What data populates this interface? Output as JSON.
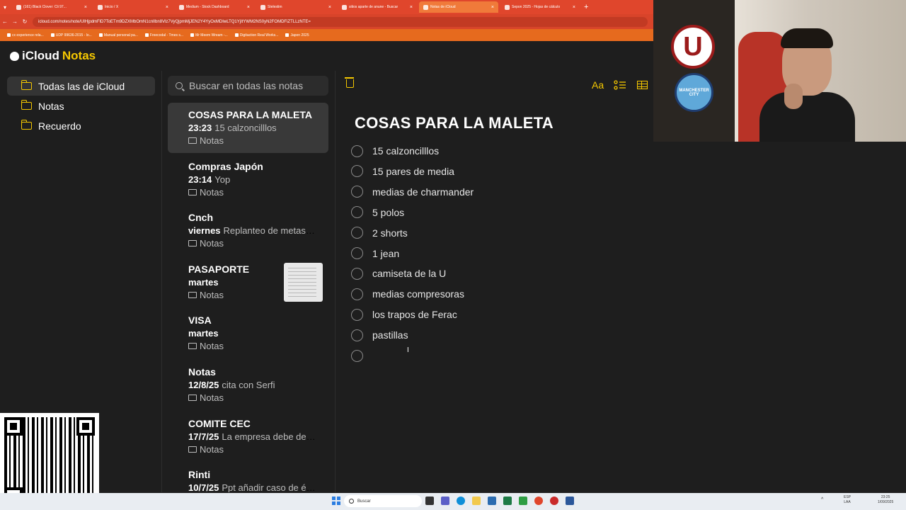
{
  "browser": {
    "tabs": [
      {
        "label": "(161) Black Clover: Cli 97...",
        "active": false
      },
      {
        "label": "Inicio / X",
        "active": false
      },
      {
        "label": "Medium - Stock Dashboard",
        "active": false
      },
      {
        "label": "Stelestim",
        "active": false
      },
      {
        "label": "sitios aparte de anune - Buscar",
        "active": false
      },
      {
        "label": "Notas de iCloud",
        "active": true
      },
      {
        "label": "Sepon 2025 - Hojas de cálculo",
        "active": false
      }
    ],
    "url": "icloud.com/notes/note/UlHjpdmFlD7ToETm9DZXMbOmN1cnlIbn8Vlz7VyQjpmMjJEN2Y4YyOxMDIwLTQ1YjItYWM2NS0yN2FOMDFiZTLLzNTE=",
    "bookmarks": [
      "cx experience rela...",
      "UDP 99636-2015 - lo...",
      "Manual personal pa...",
      "Freecodal - Tmes s...",
      "Mr Meem Wream -...",
      "Digitaction Real Works...",
      "Japon 2025"
    ]
  },
  "app": {
    "brand": {
      "icloud": "iCloud",
      "notes": "Notas"
    },
    "folders": [
      {
        "label": "Todas las de iCloud",
        "selected": true,
        "icon": "folder-icon"
      },
      {
        "label": "Notas",
        "selected": false,
        "icon": "folder-icon"
      },
      {
        "label": "Recuerdo",
        "selected": false,
        "icon": "folder-icon"
      }
    ],
    "search": {
      "placeholder": "Buscar en todas las notas"
    },
    "notes": [
      {
        "title": "COSAS PARA LA MALETA",
        "date": "23:23",
        "preview": "15 calzoncilllos",
        "folder": "Notas",
        "selected": true,
        "thumbnail": false
      },
      {
        "title": "Compras Japón",
        "date": "23:14",
        "preview": "Yop",
        "folder": "Notas",
        "selected": false,
        "thumbnail": false
      },
      {
        "title": "Cnch",
        "date": "viernes",
        "preview": "Replanteo de metas para el año",
        "folder": "Notas",
        "selected": false,
        "thumbnail": false
      },
      {
        "title": "PASAPORTE",
        "date": "martes",
        "preview": "",
        "folder": "Notas",
        "selected": false,
        "thumbnail": true
      },
      {
        "title": "VISA",
        "date": "martes",
        "preview": "",
        "folder": "Notas",
        "selected": false,
        "thumbnail": false
      },
      {
        "title": "Notas",
        "date": "12/8/25",
        "preview": "cita con Serfi",
        "folder": "Notas",
        "selected": false,
        "thumbnail": false
      },
      {
        "title": "COMITE CEC",
        "date": "17/7/25",
        "preview": "La empresa debe de cumplir",
        "folder": "Notas",
        "selected": false,
        "thumbnail": false
      },
      {
        "title": "Rinti",
        "date": "10/7/25",
        "preview": "Ppt añadir caso de éxito",
        "folder": "Notas",
        "selected": false,
        "thumbnail": false
      }
    ],
    "toolbar": {
      "format_label": "Aa"
    },
    "editor": {
      "title": "COSAS PARA LA MALETA",
      "checklist": [
        "15 calzoncilllos",
        "15 pares de media",
        "medias de charmander",
        "5 polos",
        "2 shorts",
        "1 jean",
        "camiseta de la U",
        "medias compresoras",
        "los trapos de Ferac",
        "pastillas",
        ""
      ]
    }
  },
  "overlay": {
    "logo_u": "U",
    "logo_city": "MANCHESTER CITY"
  },
  "taskbar": {
    "search_label": "Buscar",
    "lang": "ESP",
    "lang_sub": "LAA",
    "time": "23:25",
    "date": "1/09/2025"
  },
  "colors": {
    "accent": "#f5c800",
    "browser_tab_bar": "#e0462c",
    "background": "#1e1e1e"
  }
}
